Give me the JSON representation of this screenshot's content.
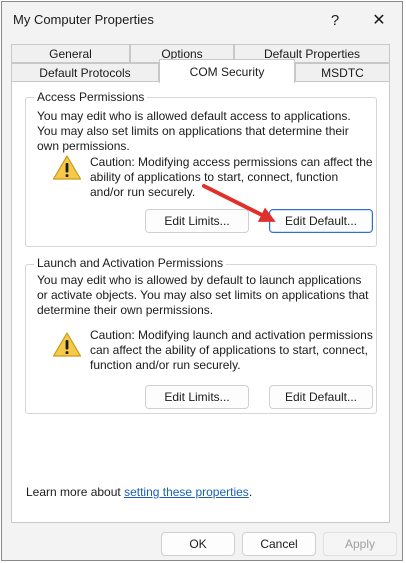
{
  "window": {
    "title": "My Computer Properties",
    "help_glyph": "?",
    "close_glyph": "✕"
  },
  "tabs": {
    "row1": [
      {
        "label": "General"
      },
      {
        "label": "Options"
      },
      {
        "label": "Default Properties"
      }
    ],
    "row2": [
      {
        "label": "Default Protocols"
      },
      {
        "label": "COM Security",
        "active": true
      },
      {
        "label": "MSDTC"
      }
    ]
  },
  "access": {
    "title": "Access Permissions",
    "description": "You may edit who is allowed default access to applications. You may also set limits on applications that determine their own permissions.",
    "caution": "Caution: Modifying access permissions can affect the ability of applications to start, connect, function and/or run securely.",
    "edit_limits": "Edit Limits...",
    "edit_default": "Edit Default..."
  },
  "launch": {
    "title": "Launch and Activation Permissions",
    "description": "You may edit who is allowed by default to launch applications or activate objects. You may also set limits on applications that determine their own permissions.",
    "caution": "Caution: Modifying launch and activation permissions can affect the ability of applications to start, connect, function and/or run securely.",
    "edit_limits": "Edit Limits...",
    "edit_default": "Edit Default..."
  },
  "learn_more": {
    "prefix": "Learn more about ",
    "link": "setting these properties",
    "suffix": "."
  },
  "footer": {
    "ok": "OK",
    "cancel": "Cancel",
    "apply": "Apply"
  },
  "colors": {
    "link": "#1a5fb4",
    "warning": "#f7c948",
    "arrow": "#e0302b",
    "focus": "#2f6fc8"
  },
  "icons": {
    "warning": "warning-icon",
    "annotation": "red-arrow-annotation"
  }
}
